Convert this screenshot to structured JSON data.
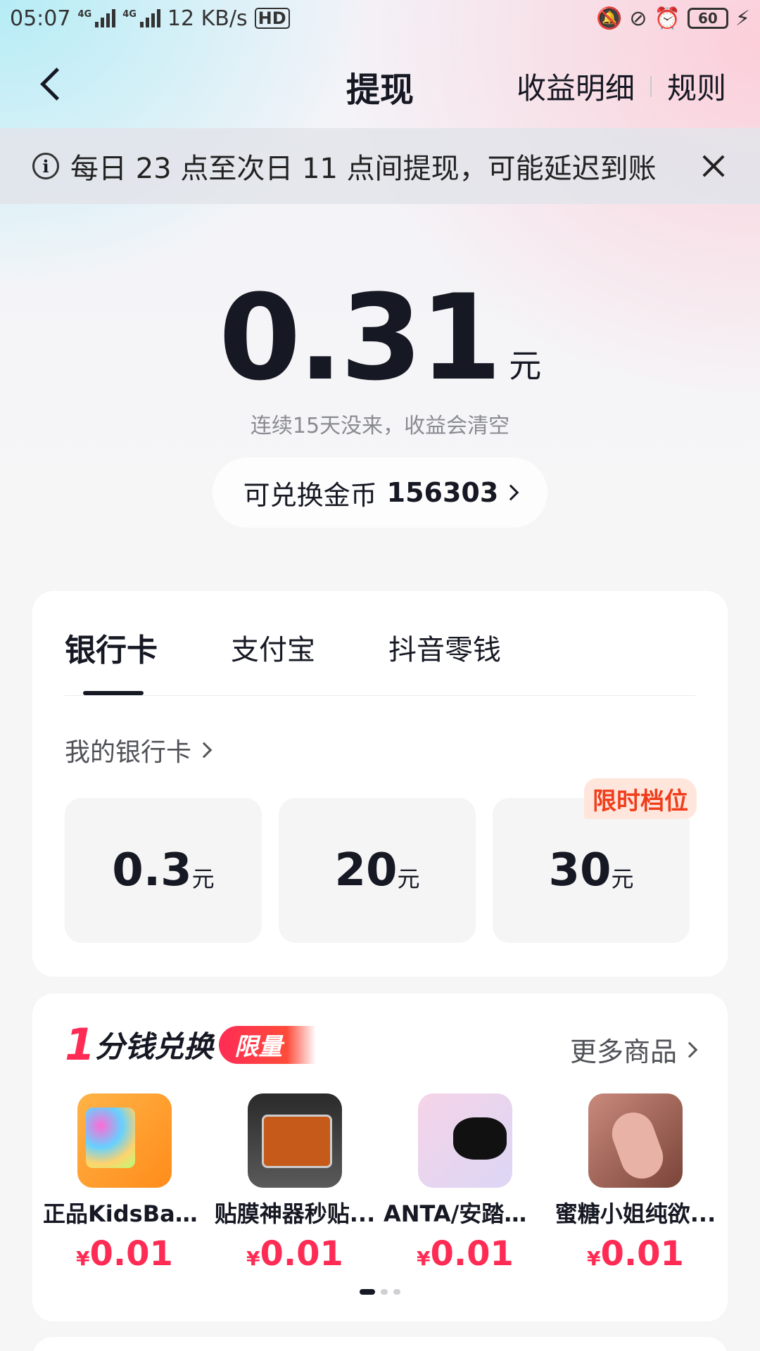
{
  "status_bar": {
    "time": "05:07",
    "signal_1": "4G",
    "signal_2": "4G",
    "speed": "12 KB/s",
    "hd": "HD",
    "battery": "60",
    "icons": [
      "mute-bell-icon",
      "lock-rotation-icon",
      "alarm-icon",
      "battery-icon",
      "charging-icon"
    ]
  },
  "nav": {
    "title": "提现",
    "earnings_detail": "收益明细",
    "rules": "规则"
  },
  "notice": {
    "text": "每日 23 点至次日 11 点间提现，可能延迟到账"
  },
  "balance": {
    "amount": "0.31",
    "unit": "元",
    "hint": "连续15天没来，收益会清空"
  },
  "coins": {
    "label": "可兑换金币",
    "value": "156303"
  },
  "withdraw": {
    "tabs": [
      {
        "label": "银行卡",
        "active": true
      },
      {
        "label": "支付宝",
        "active": false
      },
      {
        "label": "抖音零钱",
        "active": false
      }
    ],
    "my_bank_card": "我的银行卡",
    "amounts": [
      {
        "value": "0.3",
        "unit": "元",
        "badge": ""
      },
      {
        "value": "20",
        "unit": "元",
        "badge": ""
      },
      {
        "value": "30",
        "unit": "元",
        "badge": "限时档位"
      }
    ]
  },
  "exchange": {
    "title_number": "1",
    "title_text": "分钱兑换",
    "badge": "限量",
    "more": "更多商品",
    "products": [
      {
        "name": "正品KidsBan...",
        "currency": "¥",
        "price": "0.01"
      },
      {
        "name": "贴膜神器秒贴...",
        "currency": "¥",
        "price": "0.01"
      },
      {
        "name": "ANTA/安踏运...",
        "currency": "¥",
        "price": "0.01"
      },
      {
        "name": "蜜糖小姐纯欲...",
        "currency": "¥",
        "price": "0.01"
      }
    ],
    "page_count": 3,
    "current_page": 1
  },
  "colors": {
    "accent": "#fe2c55",
    "badge_text": "#f03d1c",
    "text_primary": "#161823"
  }
}
